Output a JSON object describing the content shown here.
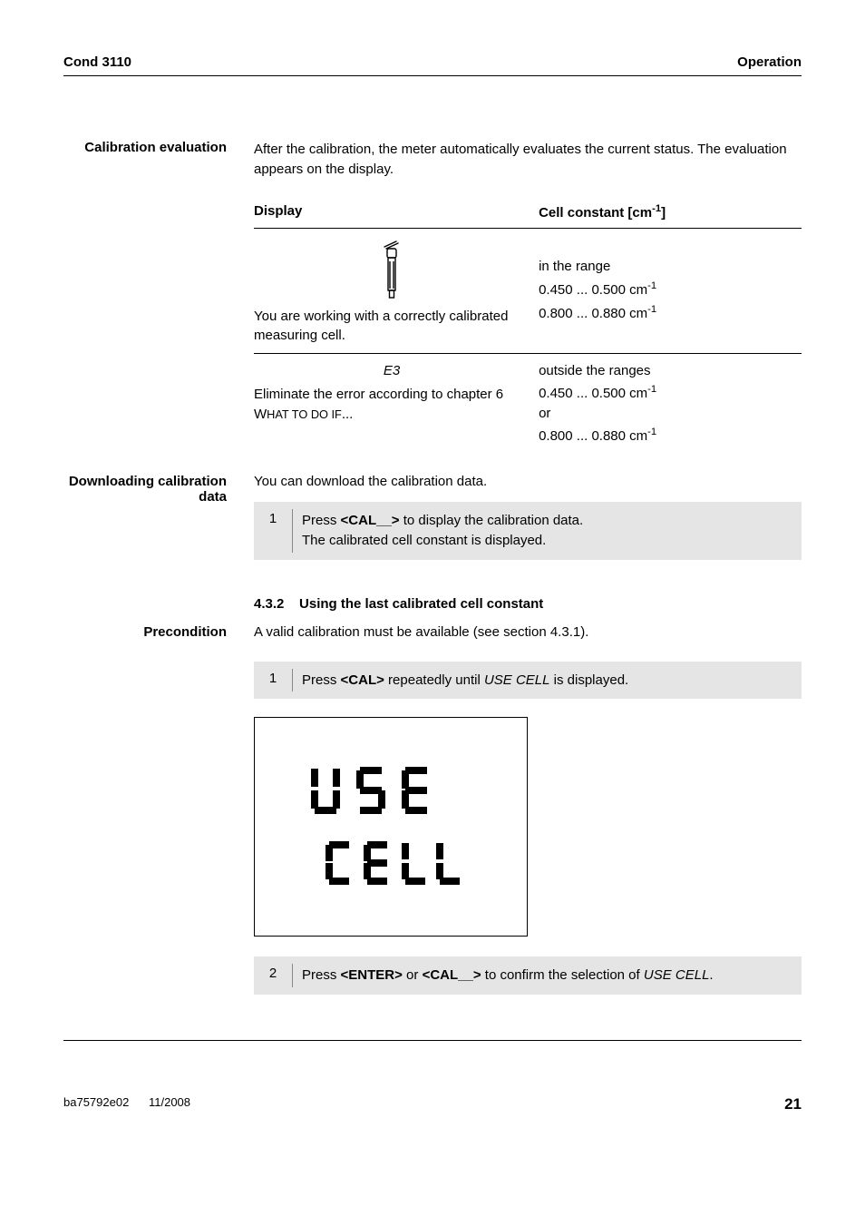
{
  "header": {
    "left": "Cond 3110",
    "right": "Operation"
  },
  "sections": {
    "calib_eval": {
      "label": "Calibration evaluation",
      "intro": "After the calibration, the meter automatically evaluates the current status. The evaluation appears on the display.",
      "table": {
        "head_display": "Display",
        "head_cellconst_html": "Cell constant [cm<sup>-1</sup>]",
        "row1_left": "You are working with a correctly calibrated measuring cell.",
        "row1_right_line1": "in the range",
        "row1_right_line2_html": "0.450 ... 0.500 cm<sup>-1</sup>",
        "row1_right_line3_html": "0.800 ... 0.880 cm<sup>-1</sup>",
        "row2_left_code": "E3",
        "row2_left_rest_html": "Eliminate the error according to chapter 6 W<span style='font-size:0.85em'>HAT TO DO IF</span>...",
        "row2_right_line1": "outside the ranges",
        "row2_right_line2_html": "0.450 ... 0.500 cm<sup>-1</sup>",
        "row2_right_line3": "or",
        "row2_right_line4_html": "0.800 ... 0.880 cm<sup>-1</sup>"
      }
    },
    "download": {
      "label_line1": "Downloading calibration",
      "label_line2": "data",
      "intro": "You can download the calibration data.",
      "step1_num": "1",
      "step1_text_html": "Press <b>&lt;CAL__&gt;</b> to display the calibration data.<br>The calibrated cell constant is displayed."
    },
    "use_last": {
      "heading_num": "4.3.2",
      "heading_text": "Using the last calibrated cell constant",
      "precond_label": "Precondition",
      "precond_text": "A valid calibration must be available (see section 4.3.1).",
      "step1_num": "1",
      "step1_text_html": "Press <b>&lt;CAL&gt;</b> repeatedly until <i>USE CELL</i> is displayed.",
      "step2_num": "2",
      "step2_text_html": "Press <b>&lt;ENTER&gt;</b> or <b>&lt;CAL__&gt;</b> to confirm the selection of <i>USE CELL</i>."
    }
  },
  "footer": {
    "left1": "ba75792e02",
    "left2": "11/2008",
    "page": "21"
  },
  "lcd": {
    "line1": "USE",
    "line2": "CELL"
  }
}
